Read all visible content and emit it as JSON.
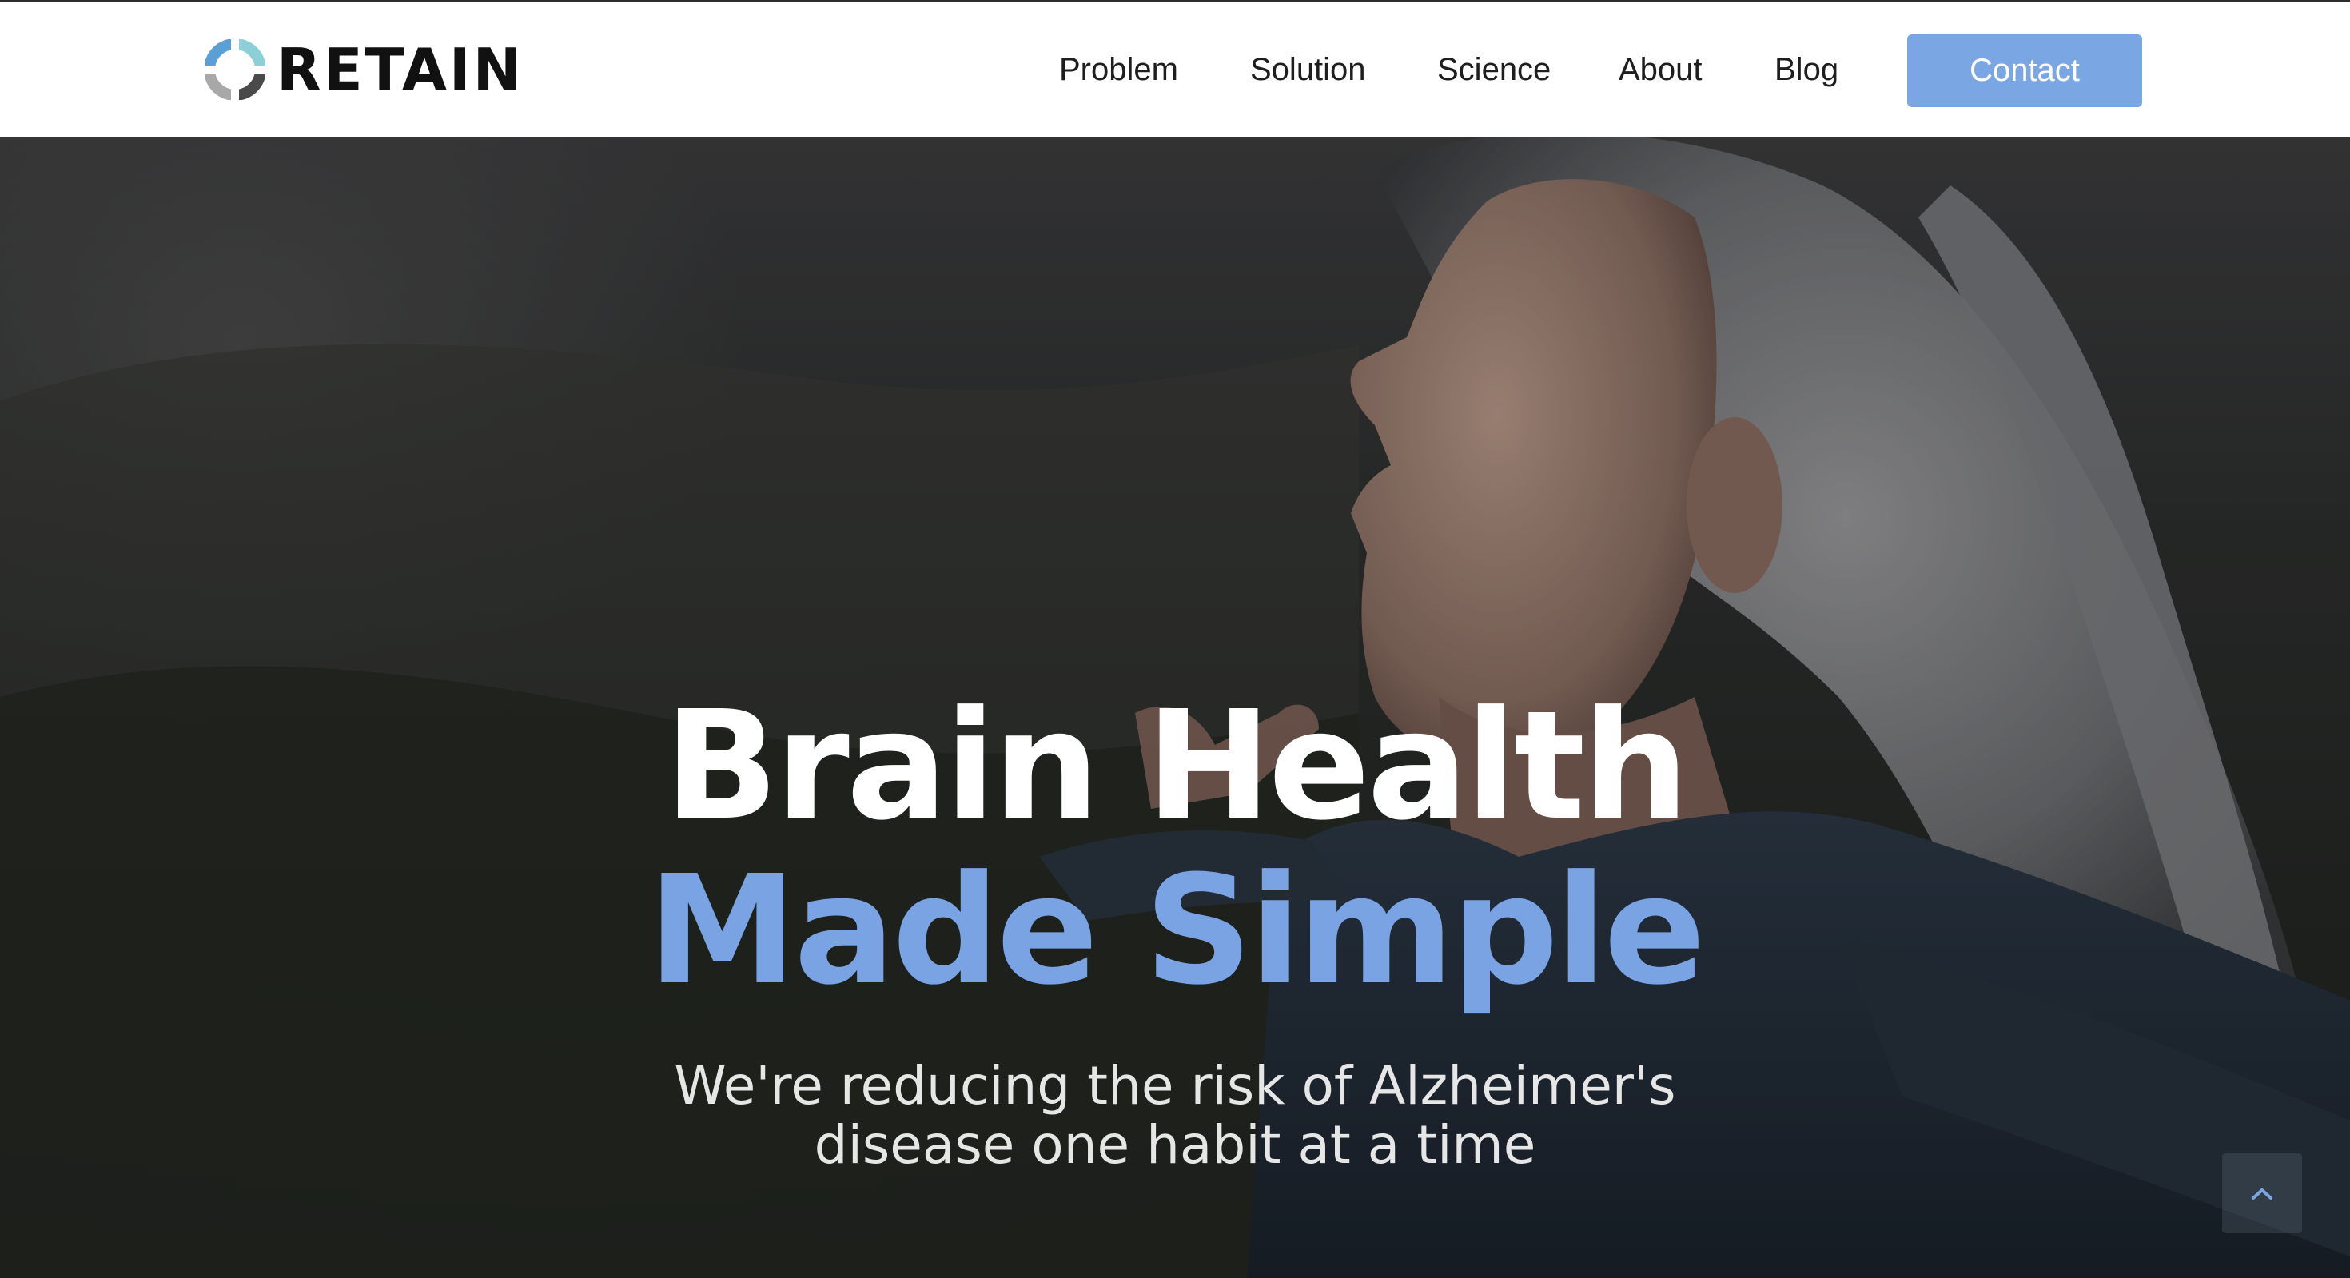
{
  "header": {
    "logo_text": "RETAIN",
    "nav": [
      {
        "label": "Problem"
      },
      {
        "label": "Solution"
      },
      {
        "label": "Science"
      },
      {
        "label": "About"
      },
      {
        "label": "Blog"
      }
    ],
    "contact_label": "Contact"
  },
  "hero": {
    "headline_line1": "Brain Health",
    "headline_line2": "Made Simple",
    "subhead": "We're reducing the risk of Alzheimer's disease one habit at a time",
    "scroll_top_icon": "chevron-up-icon"
  },
  "colors": {
    "accent": "#7aa6e3",
    "headline_accent": "#79a3e3",
    "header_bg": "#ffffff",
    "nav_text": "#1e1e1e"
  }
}
